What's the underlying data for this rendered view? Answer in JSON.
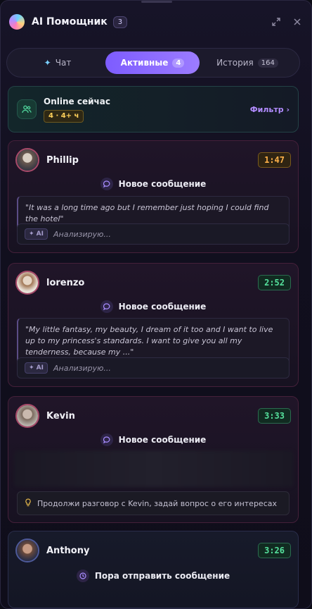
{
  "header": {
    "title": "AI Помощник",
    "count": "3"
  },
  "tabs": {
    "chat": {
      "label": "Чат"
    },
    "active": {
      "label": "Активные",
      "badge": "4"
    },
    "history": {
      "label": "История",
      "badge": "164"
    }
  },
  "online": {
    "title": "Online сейчас",
    "chip": "4 · 4+ ч",
    "filter": "Фильтр ›"
  },
  "cards": [
    {
      "name": "Phillip",
      "timer": "1:47",
      "event": "Новое сообщение",
      "quote": "\"It was a long time ago but I remember just hoping I could find the hotel\"",
      "ai_chip": "✦ AI",
      "ai_text": "Анализирую..."
    },
    {
      "name": "lorenzo",
      "timer": "2:52",
      "event": "Новое сообщение",
      "quote": "\"My little fantasy, my beauty, I dream of it too and I want to live up to my princess's standards. I want to give you all my tenderness, because my ...\"",
      "ai_chip": "✦ AI",
      "ai_text": "Анализирую..."
    },
    {
      "name": "Kevin",
      "timer": "3:33",
      "event": "Новое сообщение",
      "hint": "Продолжи разговор с Kevin, задай вопрос о его интересах"
    },
    {
      "name": "Anthony",
      "timer": "3:26",
      "event": "Пора отправить сообщение"
    }
  ],
  "colors": {
    "accent": "#8b6bff",
    "timer_orange": "#ffb24a",
    "timer_green": "#55e09c"
  }
}
